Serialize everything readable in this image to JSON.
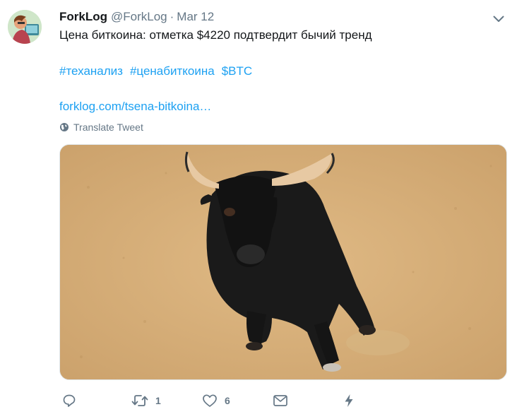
{
  "tweet": {
    "author_name": "ForkLog",
    "author_handle": "@ForkLog",
    "separator": "·",
    "date": "Mar 12",
    "text": "Цена биткоина: отметка $4220 подтвердит бычий тренд",
    "hashtags": [
      "#теханализ",
      "#ценабиткоина",
      "$BTC"
    ],
    "link": "forklog.com/tsena-bitkoina…",
    "translate_label": "Translate Tweet",
    "media_description": "bull-photo"
  },
  "actions": {
    "reply": {
      "icon": "reply-icon"
    },
    "retweet": {
      "icon": "retweet-icon",
      "count": "1"
    },
    "like": {
      "icon": "heart-icon",
      "count": "6"
    },
    "message": {
      "icon": "envelope-icon"
    },
    "analytics": {
      "icon": "lightning-icon"
    }
  },
  "colors": {
    "accent": "#1da1f2",
    "muted": "#657786",
    "text": "#14171a"
  }
}
